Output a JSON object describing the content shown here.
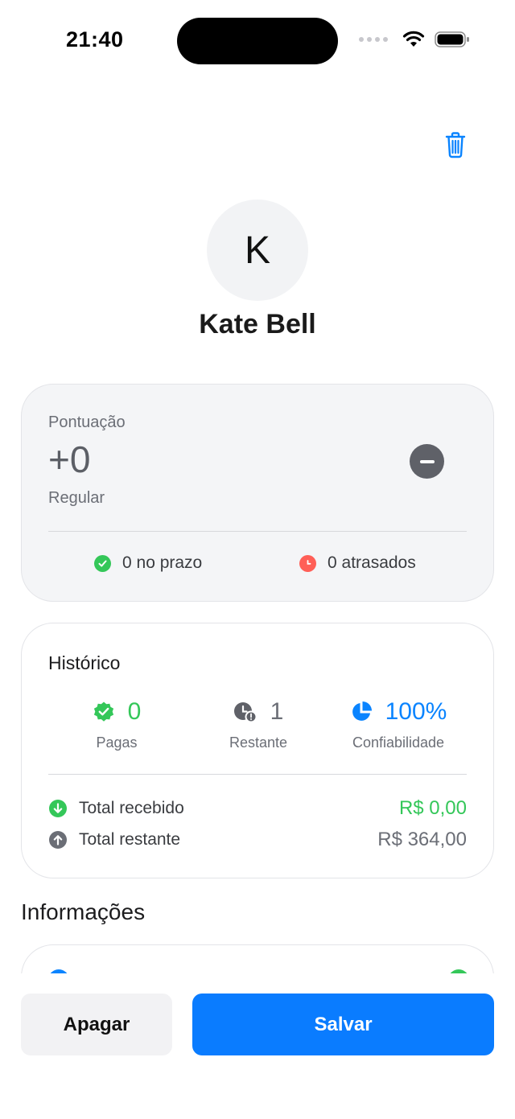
{
  "status_bar": {
    "time": "21:40"
  },
  "contact": {
    "initial": "K",
    "name": "Kate Bell"
  },
  "score": {
    "label": "Pontuação",
    "value": "+0",
    "status": "Regular",
    "on_time": "0 no prazo",
    "late": "0 atrasados"
  },
  "history": {
    "title": "Histórico",
    "metrics": [
      {
        "value": "0",
        "label": "Pagas",
        "icon": "verified-badge-icon",
        "color": "#34c759"
      },
      {
        "value": "1",
        "label": "Restante",
        "icon": "clock-alert-icon",
        "color": "#6b6e76"
      },
      {
        "value": "100%",
        "label": "Confiabilidade",
        "icon": "pie-chart-icon",
        "color": "#0a84ff"
      }
    ],
    "totals": [
      {
        "label": "Total recebido",
        "value": "R$ 0,00",
        "icon": "arrow-down-circle-icon",
        "color": "#34c759"
      },
      {
        "label": "Total restante",
        "value": "R$ 364,00",
        "icon": "arrow-up-circle-icon",
        "color": "#6b6e76"
      }
    ]
  },
  "info": {
    "title": "Informações"
  },
  "actions": {
    "delete_label": "Apagar",
    "save_label": "Salvar"
  },
  "colors": {
    "accent": "#0a7cff",
    "success": "#34c759",
    "danger": "#ff5f57",
    "neutral": "#5f6168"
  }
}
